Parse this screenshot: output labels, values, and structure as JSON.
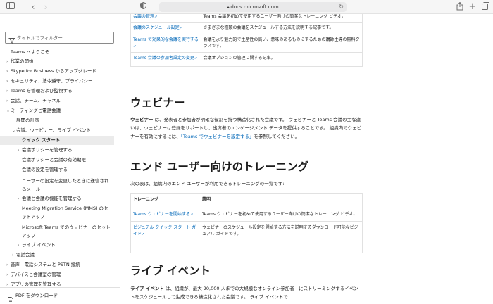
{
  "browser": {
    "address": "docs.microsoft.com",
    "icons": [
      "sidebar-icon",
      "back-icon",
      "forward-icon",
      "shield-icon",
      "lock-icon",
      "reload-icon",
      "share-icon",
      "new-tab-icon",
      "tabs-icon"
    ]
  },
  "sidebar": {
    "filter_placeholder": "タイトルでフィルター",
    "items": [
      {
        "label": "Teams へようこそ",
        "chevron": ""
      },
      {
        "label": "作業の開始",
        "chevron": "›"
      },
      {
        "label": "Skype for Business からアップグレード",
        "chevron": "›"
      },
      {
        "label": "セキュリティ、法令遵守、プライバシー",
        "chevron": "›"
      },
      {
        "label": "Teams を管理および監視する",
        "chevron": "›"
      },
      {
        "label": "会話、チーム、チャネル",
        "chevron": "›"
      },
      {
        "label": "ミーティングと電話会議",
        "chevron": "⌄"
      },
      {
        "label": "展開の計画",
        "chevron": ""
      },
      {
        "label": "会議、ウェビナー、ライブ イベント",
        "chevron": "⌄"
      },
      {
        "label": "クイック スタート",
        "chevron": ""
      },
      {
        "label": "会議ポリシーを管理する",
        "chevron": "›"
      },
      {
        "label": "会議ポリシーと会議の有効期限",
        "chevron": ""
      },
      {
        "label": "会議の設定を管理する",
        "chevron": ""
      },
      {
        "label": "ユーザーの設定を変更したときに送信されるメール",
        "chevron": ""
      },
      {
        "label": "会議と会議の機能を管理する",
        "chevron": "›"
      },
      {
        "label": "Meeting Migration Service (MMS) のセットアップ",
        "chevron": ""
      },
      {
        "label": "Microsoft Teams でのウェビナーのセットアップ",
        "chevron": ""
      },
      {
        "label": "ライブ イベント",
        "chevron": "›"
      },
      {
        "label": "電話会議",
        "chevron": "›"
      },
      {
        "label": "音声 - 電話システムと PSTN 接続",
        "chevron": "›"
      },
      {
        "label": "デバイスと会議室の管理",
        "chevron": "›"
      },
      {
        "label": "アプリの管理を管理する",
        "chevron": "›"
      }
    ],
    "pdf_label": "PDF をダウンロード"
  },
  "top_table": {
    "rows": [
      {
        "link": "会議の管理",
        "desc": "Teams 会議を初めて使用するユーザー向けの簡潔なトレーニング ビデオ。"
      },
      {
        "link": "会議のスケジュール設定",
        "desc": "さまざまな種類の会議をスケジュールする方法を説明する記事です。"
      },
      {
        "link": "Teams で効果的な会議を実行する",
        "desc": "会議をより魅力的で生産性の高い、意味のあるものにするための講師主導の無料クラスです。"
      },
      {
        "link": "Teams 会議の参加者設定の変更",
        "desc": "会議オプションの管理に関する記事。"
      }
    ]
  },
  "webinar": {
    "heading": "ウェビナー",
    "term": "ウェビナー",
    "text": " は、発表者と参加者が明確な役割を持つ構造化された会議です。 ウェビナーと Teams 会議の主な違いは、ウェビナーは登録をサポートし、出席者のエンゲージメント データを提供することです。 組織内でウェビナーを有効にするには、",
    "link": "「Teams でウェビナーを設定する」",
    "text_end": "を参照してください。"
  },
  "training": {
    "heading": "エンド ユーザー向けのトレーニング",
    "intro": "次の表は、組織内のエンド ユーザーが利用できるトレーニングの一覧です:",
    "col_training": "トレーニング",
    "col_desc": "説明",
    "rows": [
      {
        "link": "Teams ウェビナーを開始する",
        "desc": "Teams ウェビナーを初めて使用するユーザー向けの簡潔なトレーニング ビデオ。"
      },
      {
        "link": "ビジュアル クイック スタート ガイド",
        "desc": "ウェビナーのスケジュール設定を開始する方法を説明するダウンロード可能なビジュアル ガイドです。"
      }
    ]
  },
  "live": {
    "heading": "ライブ イベント",
    "term": "ライブ イベント",
    "text": " は、組織が、最大 20,000 人までの大規模なオンライン参加者—にストリーミングするイベントをスケジュールして生成できる構造化された会議です。 ライブ イベントで"
  }
}
